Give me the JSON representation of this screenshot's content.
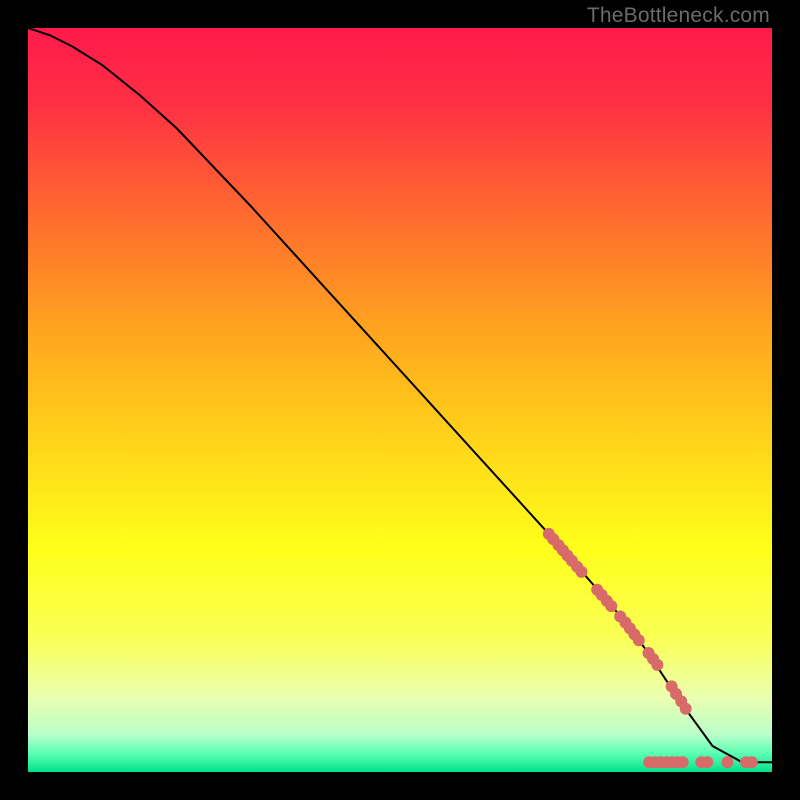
{
  "watermark": "TheBottleneck.com",
  "chart_data": {
    "type": "line",
    "title": "",
    "xlabel": "",
    "ylabel": "",
    "xlim": [
      0,
      100
    ],
    "ylim": [
      0,
      100
    ],
    "background_gradient": {
      "stops": [
        {
          "offset": 0.0,
          "color": "#ff1a4b"
        },
        {
          "offset": 0.1,
          "color": "#ff2f44"
        },
        {
          "offset": 0.25,
          "color": "#ff6a2f"
        },
        {
          "offset": 0.4,
          "color": "#ffa21f"
        },
        {
          "offset": 0.55,
          "color": "#ffd21a"
        },
        {
          "offset": 0.7,
          "color": "#ffff1a"
        },
        {
          "offset": 0.82,
          "color": "#faff55"
        },
        {
          "offset": 0.9,
          "color": "#eaffb0"
        },
        {
          "offset": 0.95,
          "color": "#b8ffca"
        },
        {
          "offset": 0.975,
          "color": "#5cffb3"
        },
        {
          "offset": 1.0,
          "color": "#00e28a"
        }
      ]
    },
    "series": [
      {
        "name": "curve",
        "type": "line",
        "color": "#000000",
        "x": [
          0,
          3,
          6,
          10,
          15,
          20,
          30,
          40,
          50,
          60,
          70,
          77,
          80,
          83,
          85,
          88,
          92,
          96,
          100
        ],
        "y": [
          100,
          99,
          97.5,
          95,
          91,
          86.5,
          76,
          65,
          54,
          43,
          32,
          24,
          20.5,
          16.5,
          13.5,
          9,
          3.5,
          1.3,
          1.3
        ]
      },
      {
        "name": "highlight-dots",
        "type": "scatter",
        "color": "#d86a6a",
        "points": [
          {
            "x": 70.0,
            "y": 32.0
          },
          {
            "x": 70.6,
            "y": 31.3
          },
          {
            "x": 71.3,
            "y": 30.5
          },
          {
            "x": 71.9,
            "y": 29.8
          },
          {
            "x": 72.5,
            "y": 29.1
          },
          {
            "x": 73.1,
            "y": 28.4
          },
          {
            "x": 73.8,
            "y": 27.6
          },
          {
            "x": 74.4,
            "y": 26.9
          },
          {
            "x": 76.5,
            "y": 24.5
          },
          {
            "x": 77.1,
            "y": 23.8
          },
          {
            "x": 77.8,
            "y": 23.0
          },
          {
            "x": 78.4,
            "y": 22.3
          },
          {
            "x": 79.6,
            "y": 20.9
          },
          {
            "x": 80.3,
            "y": 20.1
          },
          {
            "x": 80.9,
            "y": 19.3
          },
          {
            "x": 81.5,
            "y": 18.5
          },
          {
            "x": 82.1,
            "y": 17.7
          },
          {
            "x": 83.4,
            "y": 16.0
          },
          {
            "x": 84.0,
            "y": 15.2
          },
          {
            "x": 84.6,
            "y": 14.4
          },
          {
            "x": 86.5,
            "y": 11.5
          },
          {
            "x": 87.1,
            "y": 10.5
          },
          {
            "x": 87.8,
            "y": 9.5
          },
          {
            "x": 88.4,
            "y": 8.5
          },
          {
            "x": 83.5,
            "y": 1.3
          },
          {
            "x": 84.3,
            "y": 1.3
          },
          {
            "x": 85.0,
            "y": 1.3
          },
          {
            "x": 85.8,
            "y": 1.3
          },
          {
            "x": 86.5,
            "y": 1.3
          },
          {
            "x": 87.3,
            "y": 1.3
          },
          {
            "x": 88.0,
            "y": 1.3
          },
          {
            "x": 90.5,
            "y": 1.3
          },
          {
            "x": 91.3,
            "y": 1.3
          },
          {
            "x": 94.0,
            "y": 1.3
          },
          {
            "x": 96.5,
            "y": 1.3
          },
          {
            "x": 97.3,
            "y": 1.3
          }
        ]
      }
    ]
  }
}
